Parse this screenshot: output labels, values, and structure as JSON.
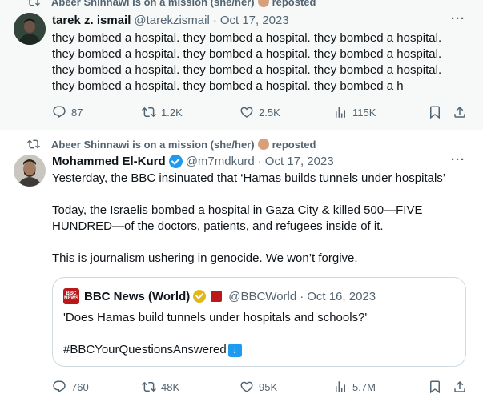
{
  "tweet1": {
    "repost_label": "Abeer Shinnawi is on a mission (she/her)",
    "repost_suffix": "reposted",
    "author_name": "tarek z. ismail",
    "author_handle": "@tarekzismail",
    "separator": "·",
    "date": "Oct 17, 2023",
    "more": "···",
    "lines": [
      "they bombed a hospital. they bombed a hospital. they bombed a hospital.",
      "they bombed a hospital. they bombed a hospital. they bombed a hospital.",
      "they bombed a hospital. they bombed a hospital. they bombed a hospital.",
      "they bombed a hospital. they bombed a hospital. they bombed a h"
    ],
    "replies": "87",
    "reposts": "1.2K",
    "likes": "2.5K",
    "views": "115K"
  },
  "tweet2": {
    "repost_label": "Abeer Shinnawi is on a mission (she/her)",
    "repost_suffix": "reposted",
    "author_name": "Mohammed El-Kurd",
    "author_handle": "@m7mdkurd",
    "separator": "·",
    "date": "Oct 17, 2023",
    "more": "···",
    "line1": "Yesterday, the BBC insinuated that ‘Hamas builds tunnels under hospitals’",
    "line2": "Today, the Israelis bombed a hospital in Gaza City & killed 500—FIVE",
    "line3": "HUNDRED—of the doctors, patients, and refugees inside of it.",
    "line4": "This is journalism ushering in genocide. We won’t forgive.",
    "quote": {
      "logo_text_top": "BBC",
      "logo_text_bottom": "NEWS",
      "name": "BBC News (World)",
      "handle": "@BBCWorld",
      "separator": "·",
      "date": "Oct 16, 2023",
      "text": "'Does Hamas build tunnels under hospitals and schools?'",
      "hashtag": "#BBCYourQuestionsAnswered"
    },
    "replies": "760",
    "reposts": "48K",
    "likes": "95K",
    "views": "5.7M"
  },
  "colors": {
    "text": "#0f1419",
    "secondary": "#536471",
    "verified_blue": "#1d9bf0",
    "verified_gold": "#e2b719",
    "bbc_red": "#bb1919",
    "highlight_bg": "#f7f9f9",
    "border": "#cfd9de"
  },
  "icons": {
    "repost": "repost-icon",
    "reply": "reply-icon",
    "like": "heart-icon",
    "views": "views-icon",
    "bookmark": "bookmark-icon",
    "share": "share-icon",
    "verified": "verified-badge-icon",
    "arrow_emoji": "down-arrow-emoji-icon"
  }
}
